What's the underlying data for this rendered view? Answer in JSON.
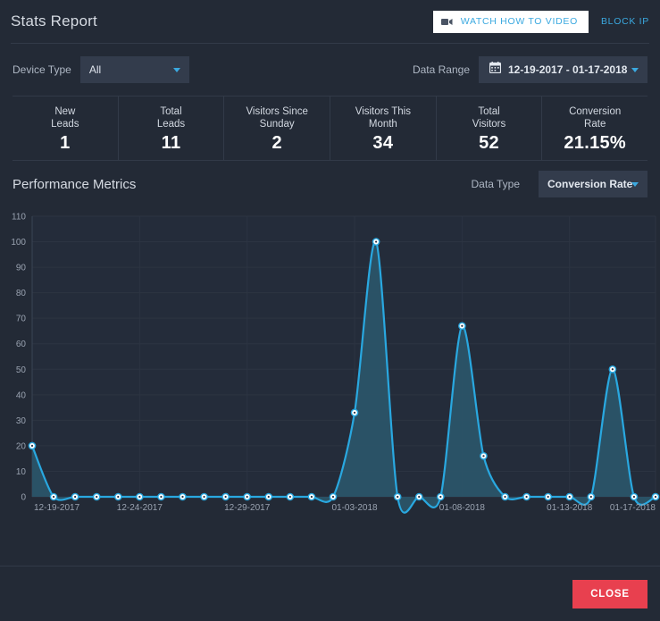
{
  "header": {
    "title": "Stats Report",
    "watch_video_label": "WATCH HOW TO VIDEO",
    "video_icon": "video-camera-icon",
    "block_ip_label": "BLOCK IP"
  },
  "filters": {
    "device_type_label": "Device Type",
    "device_type_value": "All",
    "data_range_label": "Data Range",
    "data_range_value": "12-19-2017 - 01-17-2018",
    "calendar_icon": "calendar-icon",
    "caret_icon": "chevron-down-icon"
  },
  "stats": [
    {
      "caption": "New\nLeads",
      "line1": "New",
      "line2": "Leads",
      "value": "1"
    },
    {
      "caption": "Total Leads",
      "line1": "Total",
      "line2": "Leads",
      "value": "11"
    },
    {
      "caption": "Visitors Since Sunday",
      "line1": "Visitors Since",
      "line2": "Sunday",
      "value": "2"
    },
    {
      "caption": "Visitors This Month",
      "line1": "Visitors This",
      "line2": "Month",
      "value": "34"
    },
    {
      "caption": "Total Visitors",
      "line1": "Total",
      "line2": "Visitors",
      "value": "52"
    },
    {
      "caption": "Conversion Rate",
      "line1": "Conversion",
      "line2": "Rate",
      "value": "21.15%"
    }
  ],
  "performance": {
    "title": "Performance Metrics",
    "data_type_label": "Data Type",
    "data_type_value": "Conversion Rate"
  },
  "footer": {
    "close_label": "CLOSE"
  },
  "colors": {
    "accent_blue": "#3ba9e0",
    "line_blue": "#29a8e0",
    "area_fill": "#2b5468",
    "close_red": "#e8404f",
    "panel_bg": "#232a36",
    "plot_bg": "#242c3a",
    "control_bg": "#333c4c"
  },
  "chart_data": {
    "type": "area",
    "title": "Performance Metrics",
    "series_name": "Conversion Rate",
    "xlabel": "",
    "ylabel": "",
    "ylim": [
      0,
      110
    ],
    "yticks": [
      0,
      10,
      20,
      30,
      40,
      50,
      60,
      70,
      80,
      90,
      100,
      110
    ],
    "grid": true,
    "legend": "none",
    "x_tick_labels": [
      "12-19-2017",
      "12-24-2017",
      "12-29-2017",
      "01-03-2018",
      "01-08-2018",
      "01-13-2018",
      "01-17-2018"
    ],
    "x_tick_indices": [
      0,
      5,
      10,
      15,
      20,
      25,
      29
    ],
    "x": [
      "12-19-2017",
      "12-20-2017",
      "12-21-2017",
      "12-22-2017",
      "12-23-2017",
      "12-24-2017",
      "12-25-2017",
      "12-26-2017",
      "12-27-2017",
      "12-28-2017",
      "12-29-2017",
      "12-30-2017",
      "12-31-2017",
      "01-01-2018",
      "01-02-2018",
      "01-03-2018",
      "01-04-2018",
      "01-05-2018",
      "01-06-2018",
      "01-07-2018",
      "01-08-2018",
      "01-09-2018",
      "01-10-2018",
      "01-11-2018",
      "01-12-2018",
      "01-13-2018",
      "01-14-2018",
      "01-15-2018",
      "01-16-2018",
      "01-17-2018"
    ],
    "values": [
      20,
      0,
      0,
      0,
      0,
      0,
      0,
      0,
      0,
      0,
      0,
      0,
      0,
      0,
      0,
      33,
      100,
      0,
      0,
      0,
      67,
      16,
      0,
      0,
      0,
      0,
      0,
      50,
      0,
      0
    ]
  }
}
